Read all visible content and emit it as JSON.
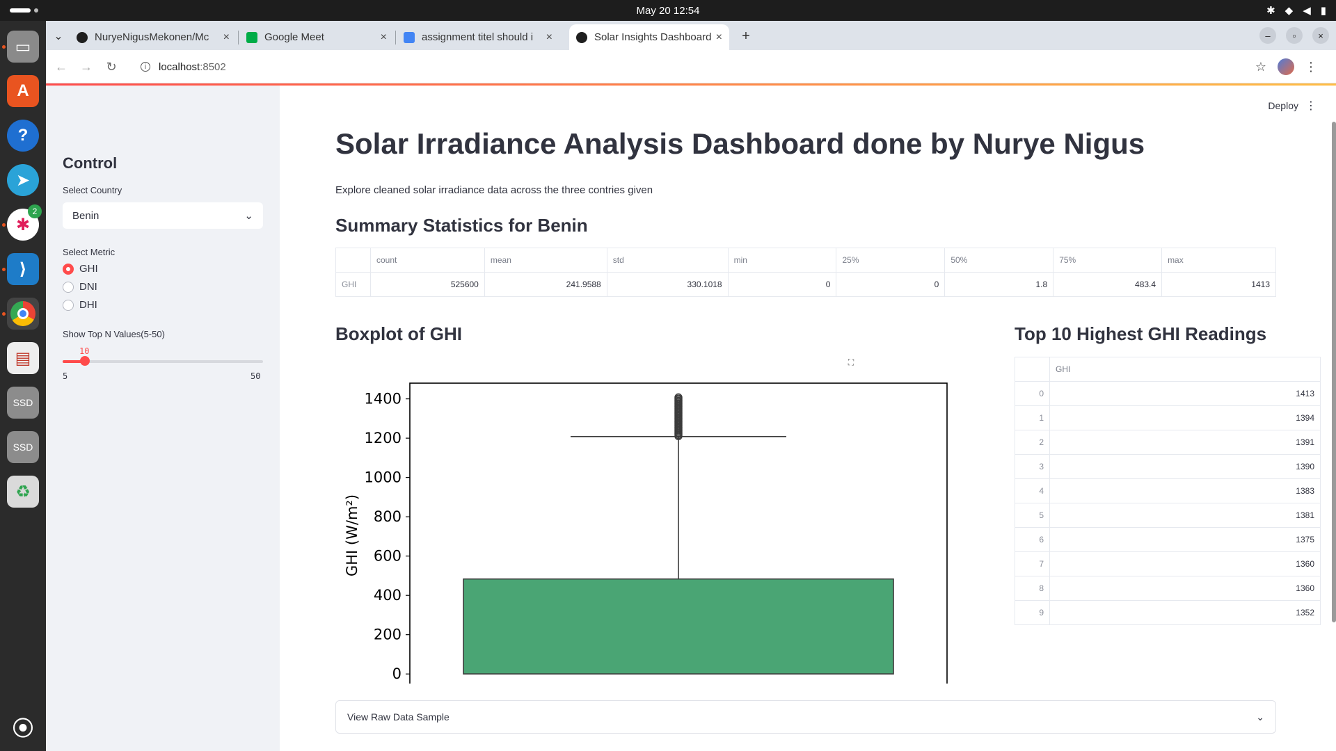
{
  "os": {
    "clock": "May 20  12:54"
  },
  "tabs": [
    {
      "title": "NuryeNigusMekonen/Mc",
      "favicon_color": "#1f1f1f"
    },
    {
      "title": "Google Meet",
      "favicon_color": "#00ac47"
    },
    {
      "title": "assignment titel should i",
      "favicon_color": "#4285f4"
    },
    {
      "title": "Solar Insights Dashboard",
      "favicon_color": "#1f1f1f"
    }
  ],
  "address_bar": {
    "host": "localhost",
    "port": ":8502"
  },
  "dock": {
    "slack_badge": "2",
    "ssd_label": "SSD"
  },
  "sidebar": {
    "heading": "Control",
    "country_label": "Select Country",
    "country_value": "Benin",
    "metric_label": "Select Metric",
    "metric_options": [
      "GHI",
      "DNI",
      "DHI"
    ],
    "metric_selected": "GHI",
    "slider_label": "Show Top N Values(5-50)",
    "slider_value": "10",
    "slider_min": "5",
    "slider_max": "50"
  },
  "header": {
    "deploy_label": "Deploy"
  },
  "main": {
    "title": "Solar Irradiance Analysis Dashboard done by Nurye Nigus",
    "subtitle": "Explore cleaned solar irradiance data across the three contries given",
    "summary_heading": "Summary Statistics for Benin",
    "summary_columns": [
      "count",
      "mean",
      "std",
      "min",
      "25%",
      "50%",
      "75%",
      "max"
    ],
    "summary_row": {
      "index": "GHI",
      "values": [
        "525600",
        "241.9588",
        "330.1018",
        "0",
        "0",
        "1.8",
        "483.4",
        "1413"
      ]
    },
    "boxplot_heading": "Boxplot of GHI",
    "top_heading": "Top 10 Highest GHI Readings",
    "top_column": "GHI",
    "top_rows": [
      {
        "index": "0",
        "value": "1413"
      },
      {
        "index": "1",
        "value": "1394"
      },
      {
        "index": "2",
        "value": "1391"
      },
      {
        "index": "3",
        "value": "1390"
      },
      {
        "index": "4",
        "value": "1383"
      },
      {
        "index": "5",
        "value": "1381"
      },
      {
        "index": "6",
        "value": "1375"
      },
      {
        "index": "7",
        "value": "1360"
      },
      {
        "index": "8",
        "value": "1360"
      },
      {
        "index": "9",
        "value": "1352"
      }
    ],
    "raw_expander_label": "View Raw Data Sample"
  },
  "colors": {
    "accent": "#ff4b4b",
    "box_fill": "#4aa574"
  },
  "chart_data": {
    "type": "box",
    "ylabel": "GHI (W/m²)",
    "ylim": [
      -70,
      1480
    ],
    "yticks": [
      0,
      200,
      400,
      600,
      800,
      1000,
      1200,
      1400
    ],
    "box": {
      "q1": 0,
      "median": 0,
      "q3": 483.4,
      "whisker_low": 0,
      "whisker_high": 1208
    },
    "outliers_range": [
      1210,
      1413
    ],
    "grid": false
  }
}
